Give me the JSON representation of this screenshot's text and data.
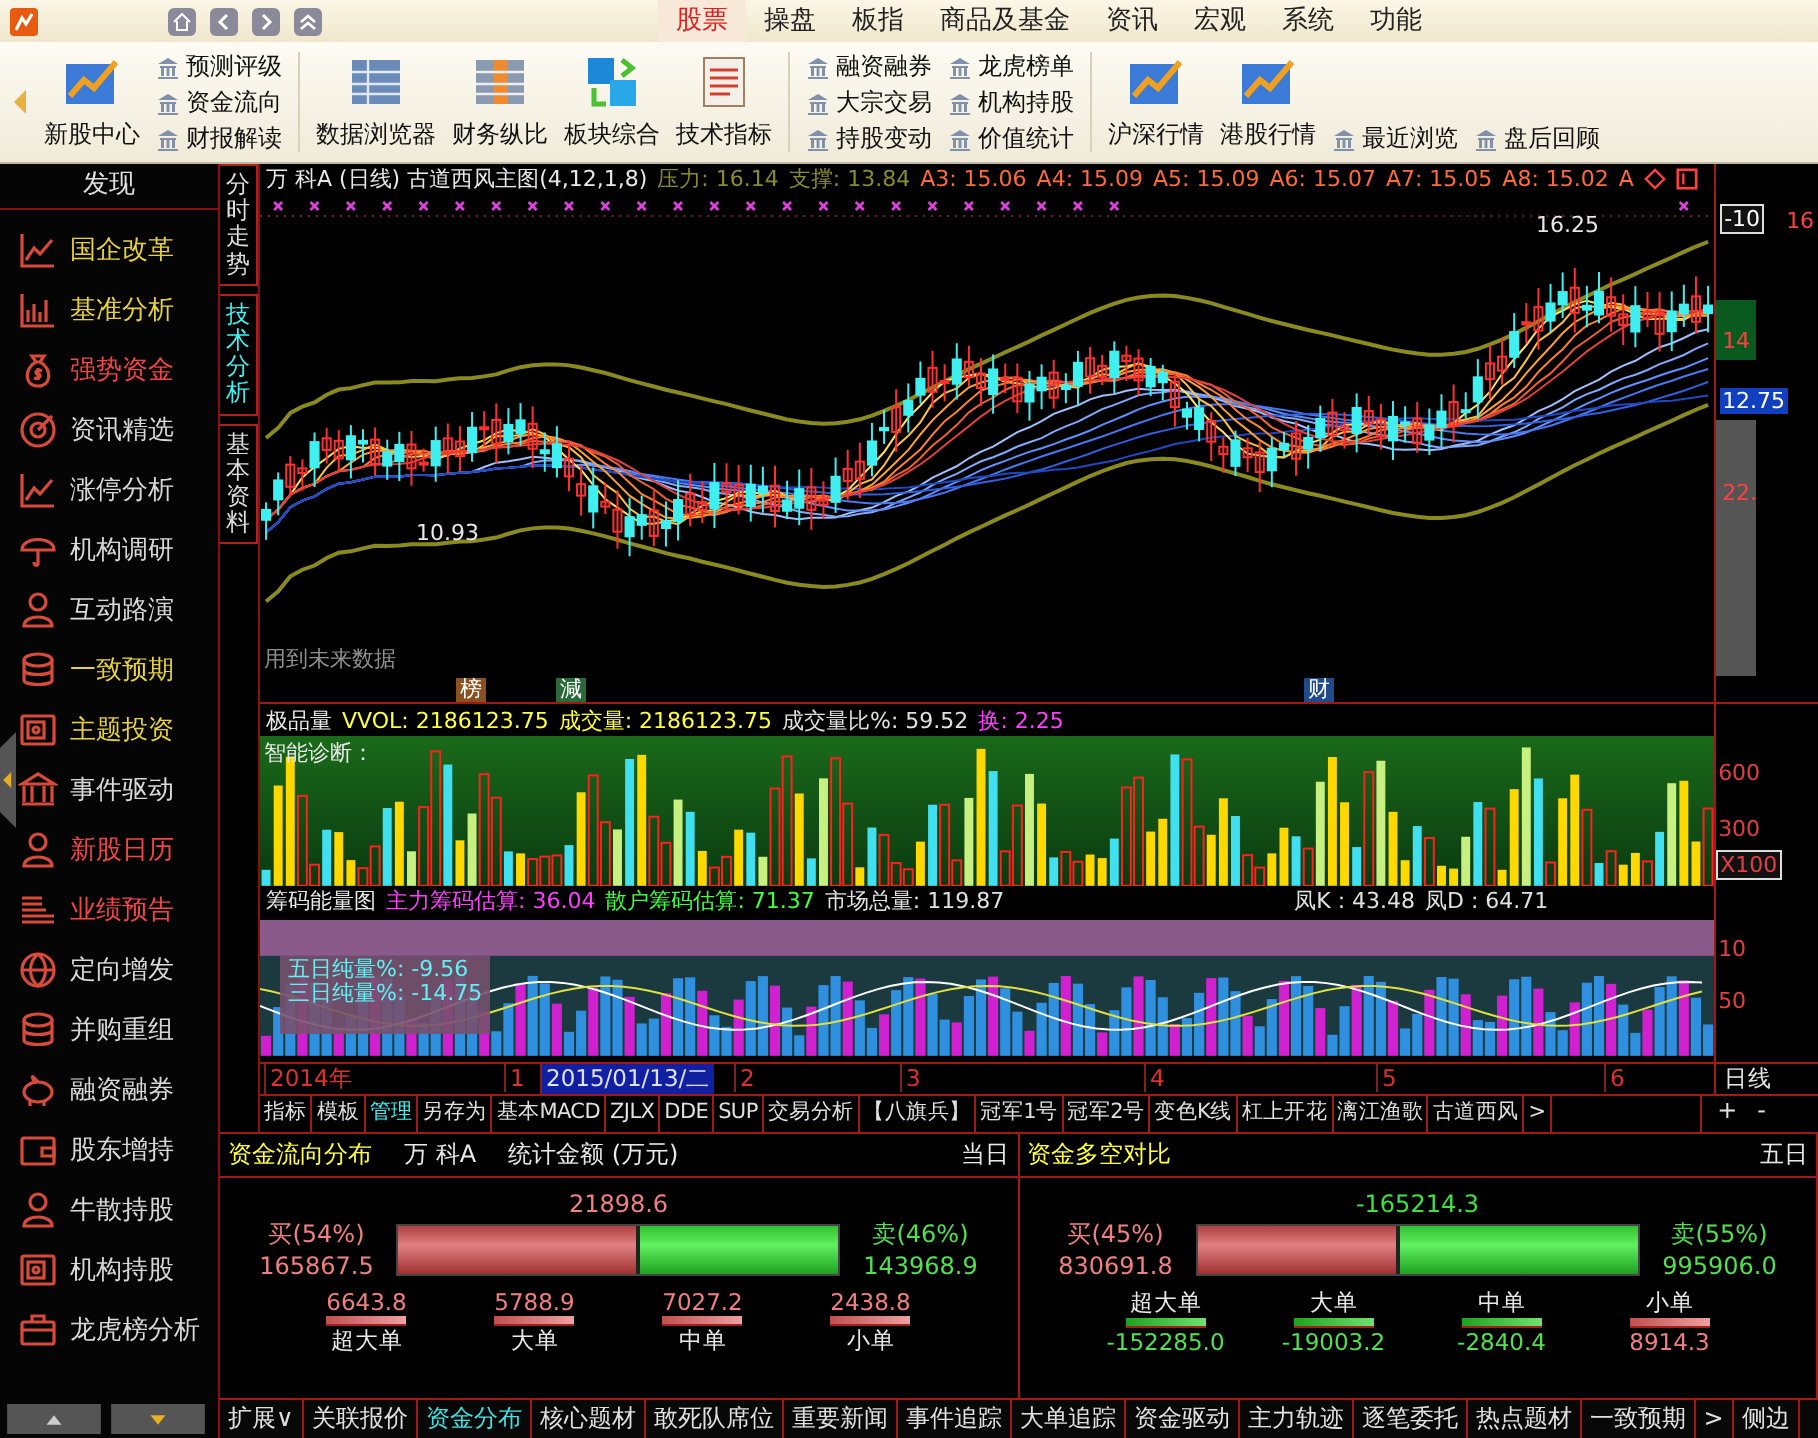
{
  "menu": {
    "items": [
      {
        "label": "股票",
        "selected": true
      },
      {
        "label": "操盘",
        "selected": false
      },
      {
        "label": "板指",
        "selected": false
      },
      {
        "label": "商品及基金",
        "selected": false
      },
      {
        "label": "资讯",
        "selected": false
      },
      {
        "label": "宏观",
        "selected": false
      },
      {
        "label": "系统",
        "selected": false
      },
      {
        "label": "功能",
        "selected": false
      }
    ]
  },
  "toolbar": {
    "items": [
      {
        "kind": "large",
        "label": "新股中心"
      },
      {
        "kind": "links",
        "links": [
          "预测评级",
          "资金流向",
          "财报解读"
        ]
      },
      {
        "kind": "large",
        "label": "数据浏览器"
      },
      {
        "kind": "large",
        "label": "财务纵比"
      },
      {
        "kind": "large",
        "label": "板块综合"
      },
      {
        "kind": "large",
        "label": "技术指标"
      },
      {
        "kind": "links",
        "links": [
          "融资融券",
          "大宗交易",
          "持股变动"
        ]
      },
      {
        "kind": "links",
        "links": [
          "龙虎榜单",
          "机构持股",
          "价值统计"
        ]
      },
      {
        "kind": "large",
        "label": "沪深行情"
      },
      {
        "kind": "large",
        "label": "港股行情"
      },
      {
        "kind": "links",
        "links": [
          "最近浏览"
        ]
      },
      {
        "kind": "links",
        "links": [
          "盘后回顾"
        ]
      }
    ]
  },
  "sidebar": {
    "title": "发现",
    "items": [
      {
        "label": "国企改革",
        "color": "#e6d23c"
      },
      {
        "label": "基准分析",
        "color": "#e6d23c"
      },
      {
        "label": "强势资金",
        "color": "#f04646"
      },
      {
        "label": "资讯精选",
        "color": "#d8d8d8"
      },
      {
        "label": "涨停分析",
        "color": "#d8d8d8"
      },
      {
        "label": "机构调研",
        "color": "#d8d8d8"
      },
      {
        "label": "互动路演",
        "color": "#d8d8d8"
      },
      {
        "label": "一致预期",
        "color": "#e6d23c"
      },
      {
        "label": "主题投资",
        "color": "#e6d23c"
      },
      {
        "label": "事件驱动",
        "color": "#d8d8d8"
      },
      {
        "label": "新股日历",
        "color": "#f04646"
      },
      {
        "label": "业绩预告",
        "color": "#f04646"
      },
      {
        "label": "定向增发",
        "color": "#d8d8d8"
      },
      {
        "label": "并购重组",
        "color": "#d8d8d8"
      },
      {
        "label": "融资融券",
        "color": "#d8d8d8"
      },
      {
        "label": "股东增持",
        "color": "#d8d8d8"
      },
      {
        "label": "牛散持股",
        "color": "#d8d8d8"
      },
      {
        "label": "机构持股",
        "color": "#d8d8d8"
      },
      {
        "label": "龙虎榜分析",
        "color": "#d8d8d8"
      }
    ]
  },
  "view_tabs": [
    {
      "label": "分时走势",
      "selected": false
    },
    {
      "label": "技术分析",
      "selected": true
    },
    {
      "label": "基本资料",
      "selected": false
    }
  ],
  "main_chart": {
    "title": "万  科A (日线) 古道西风主图(4,12,1,8)",
    "indicators": [
      {
        "kind": "band",
        "label": "压力: 16.14"
      },
      {
        "kind": "band",
        "label": "支撑: 13.84"
      },
      {
        "kind": "average",
        "label": "A3: 15.06"
      },
      {
        "kind": "average",
        "label": "A4: 15.09"
      },
      {
        "kind": "average",
        "label": "A5: 15.09"
      },
      {
        "kind": "average",
        "label": "A6: 15.07"
      },
      {
        "kind": "average",
        "label": "A7: 15.05"
      },
      {
        "kind": "average",
        "label": "A8: 15.02"
      },
      {
        "kind": "average",
        "label": "A"
      }
    ],
    "high_label": "16.25",
    "low_label": "10.93",
    "note": "用到未来数据",
    "axis_labels": [
      "-10",
      "16",
      "14",
      "12.75",
      "22."
    ],
    "markers": [
      "榜",
      "減",
      "财"
    ]
  },
  "volume_chart": {
    "name": "极品量",
    "readings": [
      {
        "kind": "yellow",
        "label": "VVOL: 2186123.75"
      },
      {
        "kind": "yellow",
        "label": "成交量: 2186123.75"
      },
      {
        "kind": "white",
        "label": "成交量比%: 59.52"
      },
      {
        "kind": "magenta",
        "label": "换: 2.25"
      }
    ],
    "panel_title": "智能诊断：",
    "axis_labels": [
      "600",
      "300",
      "X100"
    ]
  },
  "chip_chart": {
    "name": "筹码能量图",
    "readings": [
      {
        "kind": "magenta",
        "label": "主力筹码估算: 36.04"
      },
      {
        "kind": "green",
        "label": "散户筹码估算: 71.37"
      },
      {
        "kind": "white",
        "label": "市场总量: 119.87"
      },
      {
        "kind": "white",
        "label": "凤K : 43.48"
      },
      {
        "kind": "white",
        "label": "凤D : 64.71"
      }
    ],
    "overlay": [
      "五日纯量%: -9.56",
      "三日纯量%: -14.75"
    ],
    "axis_labels": [
      "10",
      "50"
    ]
  },
  "date_axis": {
    "labels": [
      {
        "label": "2014年",
        "selected": false
      },
      {
        "label": "1",
        "selected": false
      },
      {
        "label": "2015/01/13/二",
        "selected": true
      },
      {
        "label": "2",
        "selected": false
      },
      {
        "label": "3",
        "selected": false
      },
      {
        "label": "4",
        "selected": false
      },
      {
        "label": "5",
        "selected": false
      },
      {
        "label": "6",
        "selected": false
      }
    ],
    "period": "日线"
  },
  "indicator_tabs": {
    "items": [
      {
        "label": "指标",
        "selected": false
      },
      {
        "label": "模板",
        "selected": false
      },
      {
        "label": "管理",
        "selected": true
      },
      {
        "label": "另存为",
        "selected": false
      },
      {
        "label": "基本MACD",
        "selected": false
      },
      {
        "label": "ZJLX",
        "selected": false
      },
      {
        "label": "DDE",
        "selected": false
      },
      {
        "label": "SUP",
        "selected": false
      },
      {
        "label": "交易分析",
        "selected": false
      },
      {
        "label": "【八旗兵】",
        "selected": false
      },
      {
        "label": "冠军1号",
        "selected": false
      },
      {
        "label": "冠军2号",
        "selected": false
      },
      {
        "label": "变色K线",
        "selected": false
      },
      {
        "label": "杠上开花",
        "selected": false
      },
      {
        "label": "漓江渔歌",
        "selected": false
      },
      {
        "label": "古道西风",
        "selected": false
      },
      {
        "label": ">",
        "selected": false
      }
    ],
    "zoom": [
      "+",
      "-"
    ]
  },
  "panels": [
    {
      "kind": "distribution",
      "title": "资金流向分布",
      "stock": "万  科A",
      "unit": "统计金额 (万元)",
      "period": "当日",
      "total": "21898.6",
      "buy_label": "买(54%)",
      "buy_value": "165867.5",
      "sell_label": "卖(46%)",
      "sell_value": "143968.9",
      "level": 0.54,
      "orders": [
        {
          "label": "超大单",
          "value": "6643.8"
        },
        {
          "label": "大单",
          "value": "5788.9"
        },
        {
          "label": "中单",
          "value": "7027.2"
        },
        {
          "label": "小单",
          "value": "2438.8"
        }
      ]
    },
    {
      "kind": "comparison",
      "title": "资金多空对比",
      "period": "五日",
      "total": "-165214.3",
      "buy_label": "买(45%)",
      "buy_value": "830691.8",
      "sell_label": "卖(55%)",
      "sell_value": "995906.0",
      "level": 0.45,
      "orders": [
        {
          "label": "超大单",
          "value": "-152285.0"
        },
        {
          "label": "大单",
          "value": "-19003.2"
        },
        {
          "label": "中单",
          "value": "-2840.4"
        },
        {
          "label": "小单",
          "value": "8914.3"
        }
      ]
    }
  ],
  "bottom_tabs": [
    {
      "label": "扩展∨",
      "selected": false
    },
    {
      "label": "关联报价",
      "selected": false
    },
    {
      "label": "资金分布",
      "selected": true
    },
    {
      "label": "核心题材",
      "selected": false
    },
    {
      "label": "敢死队席位",
      "selected": false
    },
    {
      "label": "重要新闻",
      "selected": false
    },
    {
      "label": "事件追踪",
      "selected": false
    },
    {
      "label": "大单追踪",
      "selected": false
    },
    {
      "label": "资金驱动",
      "selected": false
    },
    {
      "label": "主力轨迹",
      "selected": false
    },
    {
      "label": "逐笔委托",
      "selected": false
    },
    {
      "label": "热点题材",
      "selected": false
    },
    {
      "label": "一致预期",
      "selected": false
    },
    {
      "label": ">",
      "selected": false
    },
    {
      "label": "侧边",
      "selected": false
    }
  ]
}
